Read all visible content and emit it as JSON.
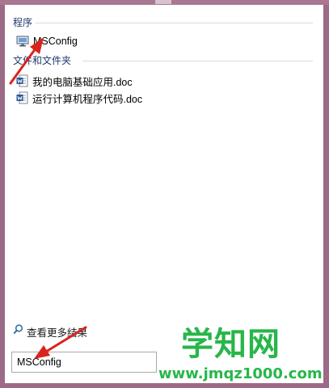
{
  "sections": {
    "programs_header": "程序",
    "files_header": "文件和文件夹"
  },
  "programs": [
    {
      "label": "MSConfig",
      "icon": "computer-icon"
    }
  ],
  "files": [
    {
      "label": "我的电脑基础应用.doc",
      "icon": "word-doc-icon"
    },
    {
      "label": "运行计算机程序代码.doc",
      "icon": "word-doc-icon"
    }
  ],
  "more_results": {
    "label": "查看更多结果",
    "icon": "search-icon"
  },
  "search": {
    "value": "MSConfig"
  },
  "watermark": {
    "big": "学知网",
    "url": "www.jmqz1000.com"
  },
  "colors": {
    "frame": "#9c6a86",
    "header_text": "#1e3a6e",
    "annotation_arrow": "#d9241e",
    "watermark": "#27b64a"
  }
}
